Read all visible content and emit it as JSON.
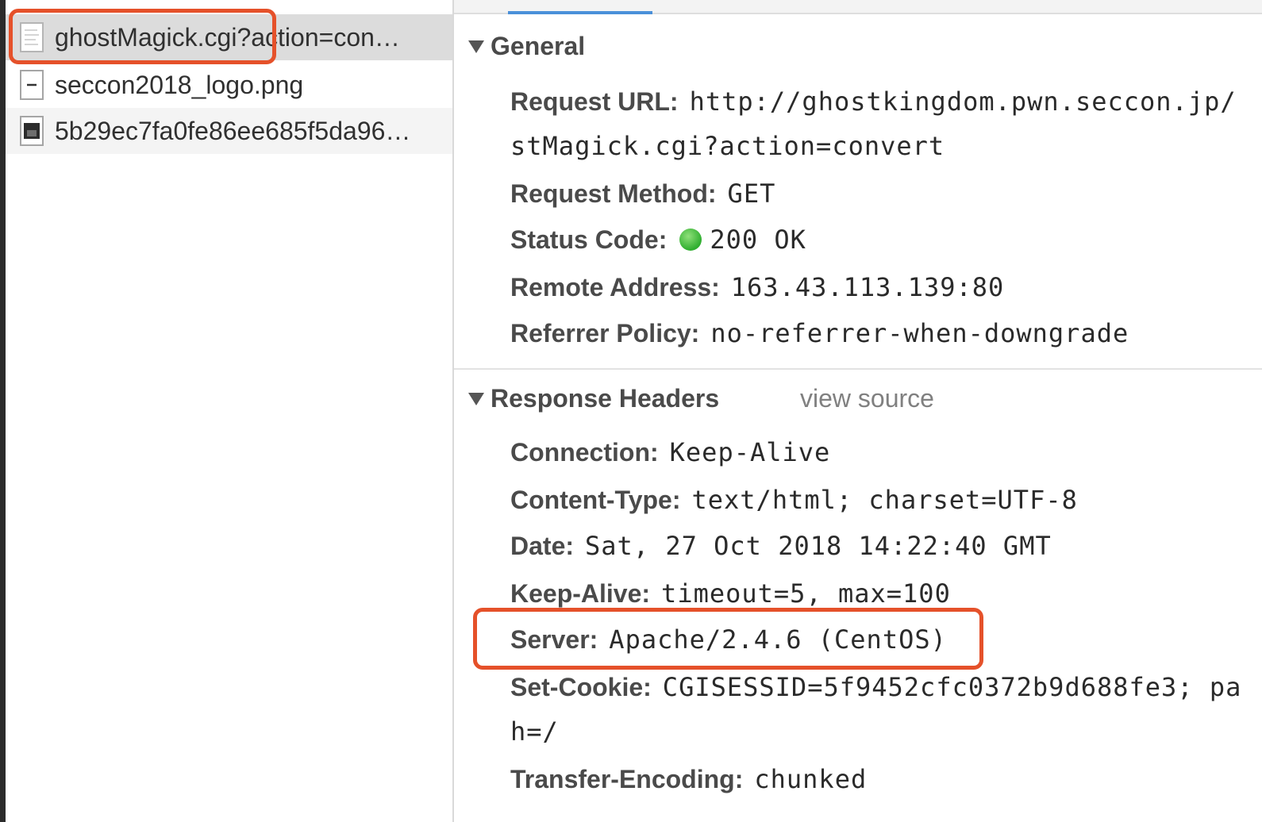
{
  "files": [
    {
      "name": "ghostMagick.cgi?action=con…",
      "icon": "document-icon"
    },
    {
      "name": "seccon2018_logo.png",
      "icon": "image-placeholder-icon"
    },
    {
      "name": "5b29ec7fa0fe86ee685f5da96…",
      "icon": "image-thumbnail-icon"
    }
  ],
  "general": {
    "title": "General",
    "request_url_key": "Request URL:",
    "request_url_val": "http://ghostkingdom.pwn.seccon.jp/",
    "request_url_cont": "stMagick.cgi?action=convert",
    "method_key": "Request Method:",
    "method_val": "GET",
    "status_key": "Status Code:",
    "status_val": "200 OK",
    "status_color": "#2fae2f",
    "remote_key": "Remote Address:",
    "remote_val": "163.43.113.139:80",
    "referrer_key": "Referrer Policy:",
    "referrer_val": "no-referrer-when-downgrade"
  },
  "response": {
    "title": "Response Headers",
    "view_source": "view source",
    "connection_key": "Connection:",
    "connection_val": "Keep-Alive",
    "ctype_key": "Content-Type:",
    "ctype_val": "text/html; charset=UTF-8",
    "date_key": "Date:",
    "date_val": "Sat, 27 Oct 2018 14:22:40 GMT",
    "keepalive_key": "Keep-Alive:",
    "keepalive_val": "timeout=5, max=100",
    "server_key": "Server:",
    "server_val": "Apache/2.4.6 (CentOS)",
    "cookie_key": "Set-Cookie:",
    "cookie_val": "CGISESSID=5f9452cfc0372b9d688fe3; pa",
    "cookie_cont": "h=/",
    "te_key": "Transfer-Encoding:",
    "te_val": "chunked"
  },
  "highlight_color": "#e5512a"
}
